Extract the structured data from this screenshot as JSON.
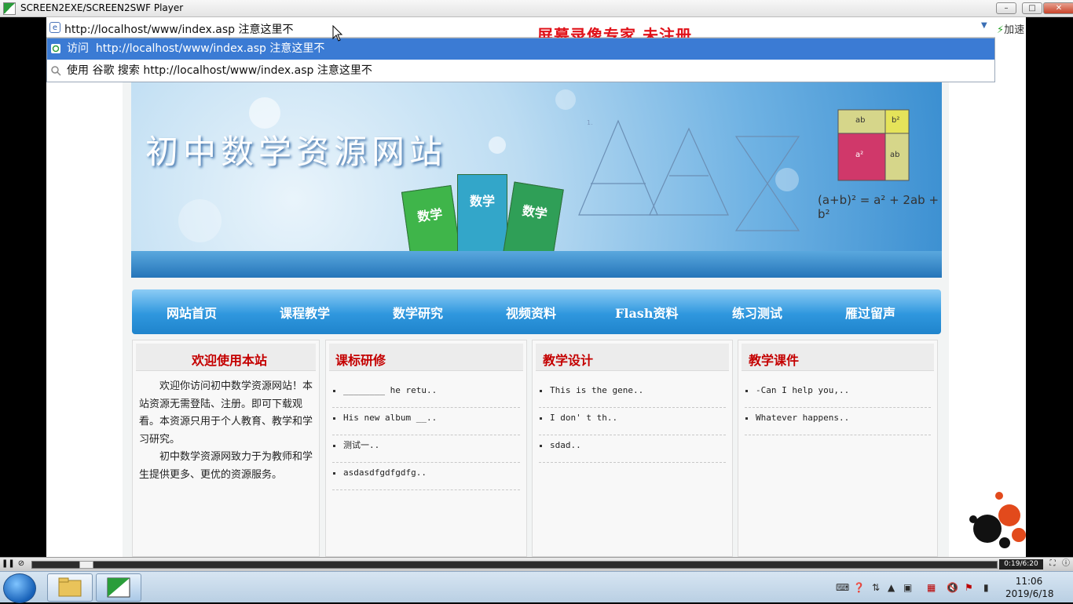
{
  "window": {
    "title": "SCREEN2EXE/SCREEN2SWF Player",
    "minimize": "–",
    "maximize": "□",
    "close": "✕"
  },
  "browser": {
    "address_value": "http://localhost/www/index.asp 注意这里不",
    "watermark": "屏幕录像专家  未注册",
    "accelerator": "加速",
    "suggestions": [
      {
        "prefix": "访问",
        "text": "http://localhost/www/index.asp 注意这里不"
      },
      {
        "text": "使用 谷歌 搜索 http://localhost/www/index.asp 注意这里不"
      }
    ]
  },
  "banner": {
    "site_title": "初中数学资源网站",
    "book_label": "数学",
    "formula": "(a+b)² = a² + 2ab + b²",
    "formula_box": [
      "ab",
      "b²",
      "a²",
      "ab"
    ]
  },
  "nav": {
    "items": [
      "网站首页",
      "课程教学",
      "数学研究",
      "视频资料",
      "Flash资料",
      "练习测试",
      "雁过留声"
    ]
  },
  "boxes": {
    "welcome": {
      "title": "欢迎使用本站",
      "paragraphs": [
        "欢迎你访问初中数学资源网站！本站资源无需登陆、注册。即可下载观看。本资源只用于个人教育、教学和学习研究。",
        "初中数学资源网致力于为教师和学生提供更多、更优的资源服务。"
      ]
    },
    "curriculum": {
      "title": "课标研修",
      "items": [
        "________ he retu..",
        "His new album __..",
        "测试一..",
        "asdasdfgdfgdfg.."
      ]
    },
    "design": {
      "title": "教学设计",
      "items": [
        "This is the gene..",
        "I don' t th..",
        "sdad.."
      ]
    },
    "courseware": {
      "title": "教学课件",
      "items": [
        "-Can I help you,..",
        "Whatever happens.."
      ]
    }
  },
  "player": {
    "time": "0:19/6:20"
  },
  "taskbar": {
    "time": "11:06",
    "date": "2019/6/18"
  },
  "colors": {
    "watermark": "#e0121a",
    "box_title": "#c40000",
    "nav_blue": "#2f97de",
    "suggest_selected": "#3b7bd4"
  }
}
